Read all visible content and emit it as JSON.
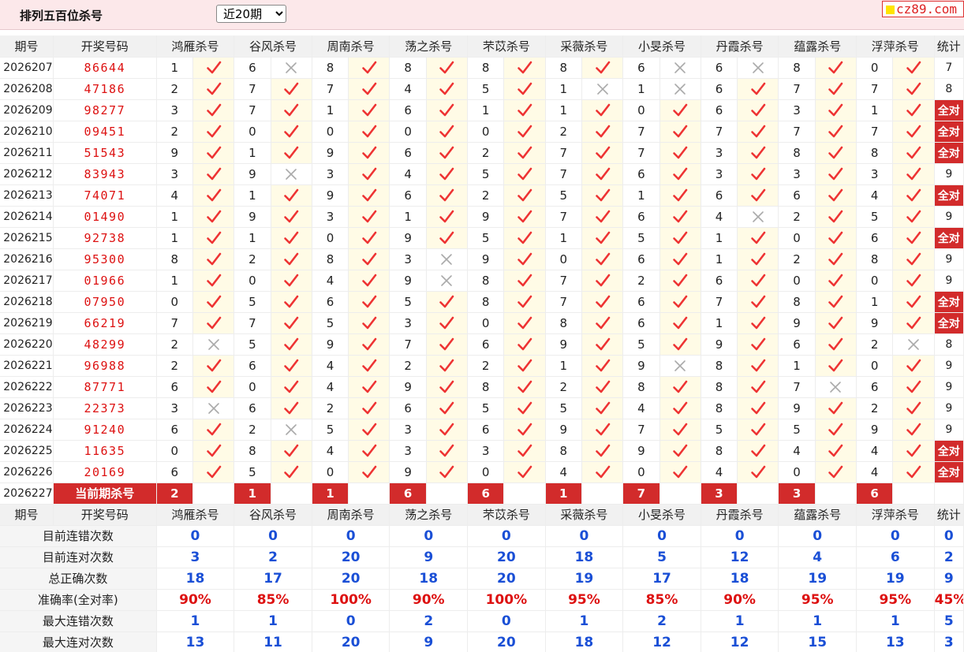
{
  "header": {
    "title": "排列五百位杀号",
    "period_select": {
      "selected": "近20期"
    },
    "logo_text": "cz89.com"
  },
  "columns": {
    "period": "期号",
    "draw": "开奖号码",
    "experts": [
      "鸿雁杀号",
      "谷风杀号",
      "周南杀号",
      "荡之杀号",
      "芣苡杀号",
      "采薇杀号",
      "小旻杀号",
      "丹霞杀号",
      "蕴露杀号",
      "浮萍杀号"
    ],
    "count": "统计"
  },
  "full_label": "全对",
  "rows": [
    {
      "period": "2026207",
      "draw": "86644",
      "kills": [
        "1",
        "6",
        "8",
        "8",
        "8",
        "8",
        "6",
        "6",
        "8",
        "0"
      ],
      "marks": [
        "v",
        "x",
        "v",
        "v",
        "v",
        "v",
        "x",
        "x",
        "v",
        "v"
      ],
      "count": "7"
    },
    {
      "period": "2026208",
      "draw": "47186",
      "kills": [
        "2",
        "7",
        "7",
        "4",
        "5",
        "1",
        "1",
        "6",
        "7",
        "7"
      ],
      "marks": [
        "v",
        "v",
        "v",
        "v",
        "v",
        "x",
        "x",
        "v",
        "v",
        "v"
      ],
      "count": "8"
    },
    {
      "period": "2026209",
      "draw": "98277",
      "kills": [
        "3",
        "7",
        "1",
        "6",
        "1",
        "1",
        "0",
        "6",
        "3",
        "1"
      ],
      "marks": [
        "v",
        "v",
        "v",
        "v",
        "v",
        "v",
        "v",
        "v",
        "v",
        "v"
      ],
      "count": "全对"
    },
    {
      "period": "2026210",
      "draw": "09451",
      "kills": [
        "2",
        "0",
        "0",
        "0",
        "0",
        "2",
        "7",
        "7",
        "7",
        "7"
      ],
      "marks": [
        "v",
        "v",
        "v",
        "v",
        "v",
        "v",
        "v",
        "v",
        "v",
        "v"
      ],
      "count": "全对"
    },
    {
      "period": "2026211",
      "draw": "51543",
      "kills": [
        "9",
        "1",
        "9",
        "6",
        "2",
        "7",
        "7",
        "3",
        "8",
        "8"
      ],
      "marks": [
        "v",
        "v",
        "v",
        "v",
        "v",
        "v",
        "v",
        "v",
        "v",
        "v"
      ],
      "count": "全对"
    },
    {
      "period": "2026212",
      "draw": "83943",
      "kills": [
        "3",
        "9",
        "3",
        "4",
        "5",
        "7",
        "6",
        "3",
        "3",
        "3"
      ],
      "marks": [
        "v",
        "x",
        "v",
        "v",
        "v",
        "v",
        "v",
        "v",
        "v",
        "v"
      ],
      "count": "9"
    },
    {
      "period": "2026213",
      "draw": "74071",
      "kills": [
        "4",
        "1",
        "9",
        "6",
        "2",
        "5",
        "1",
        "6",
        "6",
        "4"
      ],
      "marks": [
        "v",
        "v",
        "v",
        "v",
        "v",
        "v",
        "v",
        "v",
        "v",
        "v"
      ],
      "count": "全对"
    },
    {
      "period": "2026214",
      "draw": "01490",
      "kills": [
        "1",
        "9",
        "3",
        "1",
        "9",
        "7",
        "6",
        "4",
        "2",
        "5"
      ],
      "marks": [
        "v",
        "v",
        "v",
        "v",
        "v",
        "v",
        "v",
        "x",
        "v",
        "v"
      ],
      "count": "9"
    },
    {
      "period": "2026215",
      "draw": "92738",
      "kills": [
        "1",
        "1",
        "0",
        "9",
        "5",
        "1",
        "5",
        "1",
        "0",
        "6"
      ],
      "marks": [
        "v",
        "v",
        "v",
        "v",
        "v",
        "v",
        "v",
        "v",
        "v",
        "v"
      ],
      "count": "全对"
    },
    {
      "period": "2026216",
      "draw": "95300",
      "kills": [
        "8",
        "2",
        "8",
        "3",
        "9",
        "0",
        "6",
        "1",
        "2",
        "8"
      ],
      "marks": [
        "v",
        "v",
        "v",
        "x",
        "v",
        "v",
        "v",
        "v",
        "v",
        "v"
      ],
      "count": "9"
    },
    {
      "period": "2026217",
      "draw": "01966",
      "kills": [
        "1",
        "0",
        "4",
        "9",
        "8",
        "7",
        "2",
        "6",
        "0",
        "0"
      ],
      "marks": [
        "v",
        "v",
        "v",
        "x",
        "v",
        "v",
        "v",
        "v",
        "v",
        "v"
      ],
      "count": "9"
    },
    {
      "period": "2026218",
      "draw": "07950",
      "kills": [
        "0",
        "5",
        "6",
        "5",
        "8",
        "7",
        "6",
        "7",
        "8",
        "1"
      ],
      "marks": [
        "v",
        "v",
        "v",
        "v",
        "v",
        "v",
        "v",
        "v",
        "v",
        "v"
      ],
      "count": "全对"
    },
    {
      "period": "2026219",
      "draw": "66219",
      "kills": [
        "7",
        "7",
        "5",
        "3",
        "0",
        "8",
        "6",
        "1",
        "9",
        "9"
      ],
      "marks": [
        "v",
        "v",
        "v",
        "v",
        "v",
        "v",
        "v",
        "v",
        "v",
        "v"
      ],
      "count": "全对"
    },
    {
      "period": "2026220",
      "draw": "48299",
      "kills": [
        "2",
        "5",
        "9",
        "7",
        "6",
        "9",
        "5",
        "9",
        "6",
        "2"
      ],
      "marks": [
        "x",
        "v",
        "v",
        "v",
        "v",
        "v",
        "v",
        "v",
        "v",
        "x"
      ],
      "count": "8"
    },
    {
      "period": "2026221",
      "draw": "96988",
      "kills": [
        "2",
        "6",
        "4",
        "2",
        "2",
        "1",
        "9",
        "8",
        "1",
        "0"
      ],
      "marks": [
        "v",
        "v",
        "v",
        "v",
        "v",
        "v",
        "x",
        "v",
        "v",
        "v"
      ],
      "count": "9"
    },
    {
      "period": "2026222",
      "draw": "87771",
      "kills": [
        "6",
        "0",
        "4",
        "9",
        "8",
        "2",
        "8",
        "8",
        "7",
        "6"
      ],
      "marks": [
        "v",
        "v",
        "v",
        "v",
        "v",
        "v",
        "v",
        "v",
        "x",
        "v"
      ],
      "count": "9"
    },
    {
      "period": "2026223",
      "draw": "22373",
      "kills": [
        "3",
        "6",
        "2",
        "6",
        "5",
        "5",
        "4",
        "8",
        "9",
        "2"
      ],
      "marks": [
        "x",
        "v",
        "v",
        "v",
        "v",
        "v",
        "v",
        "v",
        "v",
        "v"
      ],
      "count": "9"
    },
    {
      "period": "2026224",
      "draw": "91240",
      "kills": [
        "6",
        "2",
        "5",
        "3",
        "6",
        "9",
        "7",
        "5",
        "5",
        "9"
      ],
      "marks": [
        "v",
        "x",
        "v",
        "v",
        "v",
        "v",
        "v",
        "v",
        "v",
        "v"
      ],
      "count": "9"
    },
    {
      "period": "2026225",
      "draw": "11635",
      "kills": [
        "0",
        "8",
        "4",
        "3",
        "3",
        "8",
        "9",
        "8",
        "4",
        "4"
      ],
      "marks": [
        "v",
        "v",
        "v",
        "v",
        "v",
        "v",
        "v",
        "v",
        "v",
        "v"
      ],
      "count": "全对"
    },
    {
      "period": "2026226",
      "draw": "20169",
      "kills": [
        "6",
        "5",
        "0",
        "9",
        "0",
        "4",
        "0",
        "4",
        "0",
        "4"
      ],
      "marks": [
        "v",
        "v",
        "v",
        "v",
        "v",
        "v",
        "v",
        "v",
        "v",
        "v"
      ],
      "count": "全对"
    }
  ],
  "current": {
    "period": "2026227",
    "label": "当前期杀号",
    "kills": [
      "2",
      "1",
      "1",
      "6",
      "6",
      "1",
      "7",
      "3",
      "3",
      "6"
    ]
  },
  "stats": [
    {
      "label": "目前连错次数",
      "values": [
        "0",
        "0",
        "0",
        "0",
        "0",
        "0",
        "0",
        "0",
        "0",
        "0"
      ],
      "total": "0"
    },
    {
      "label": "目前连对次数",
      "values": [
        "3",
        "2",
        "20",
        "9",
        "20",
        "18",
        "5",
        "12",
        "4",
        "6"
      ],
      "total": "2"
    },
    {
      "label": "总正确次数",
      "values": [
        "18",
        "17",
        "20",
        "18",
        "20",
        "19",
        "17",
        "18",
        "19",
        "19"
      ],
      "total": "9"
    },
    {
      "label": "准确率(全对率)",
      "values": [
        "90%",
        "85%",
        "100%",
        "90%",
        "100%",
        "95%",
        "85%",
        "90%",
        "95%",
        "95%"
      ],
      "total": "45%"
    },
    {
      "label": "最大连错次数",
      "values": [
        "1",
        "1",
        "0",
        "2",
        "0",
        "1",
        "2",
        "1",
        "1",
        "1"
      ],
      "total": "5"
    },
    {
      "label": "最大连对次数",
      "values": [
        "13",
        "11",
        "20",
        "9",
        "20",
        "18",
        "12",
        "12",
        "15",
        "13"
      ],
      "total": "3"
    }
  ],
  "colors": {
    "accent_red": "#d22b2b",
    "draw_red": "#d11",
    "stat_blue": "#1a4fd6",
    "header_bg": "#fce8ea"
  },
  "icons": {
    "correct": "check-icon",
    "wrong": "cross-icon"
  }
}
